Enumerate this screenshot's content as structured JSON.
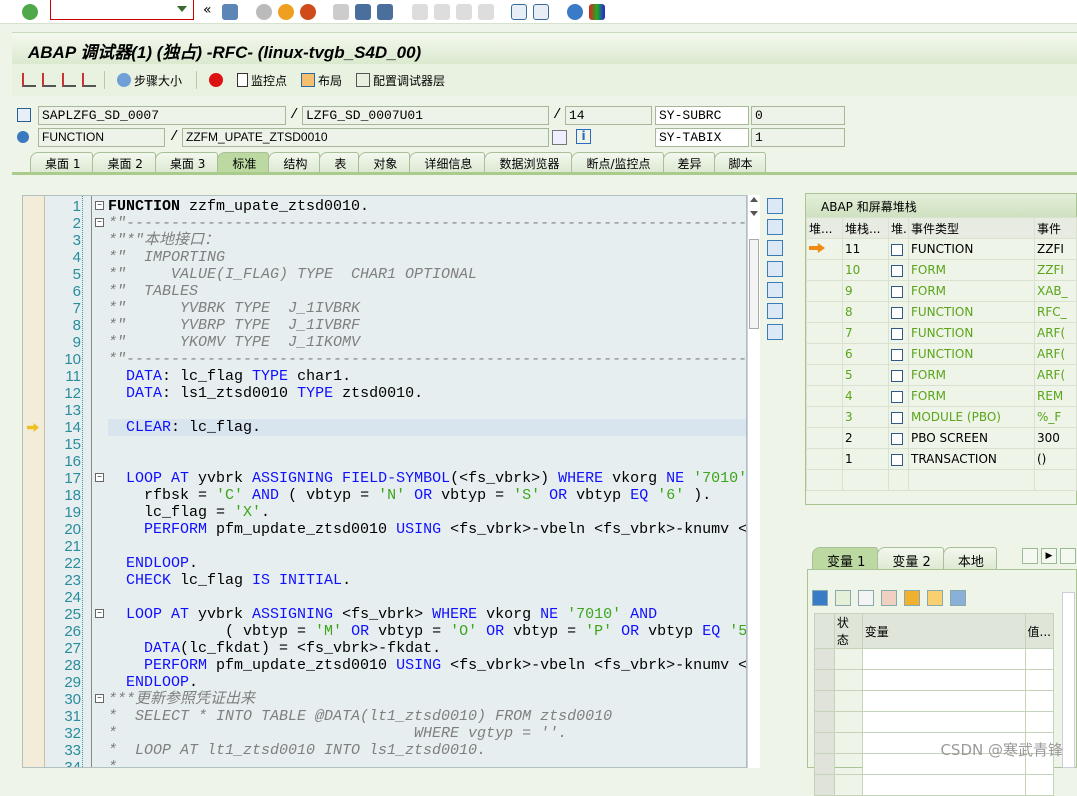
{
  "system_toolbar": {
    "command_field": "",
    "icons": [
      "check-icon",
      "back-icon",
      "save-icon",
      "nav-back-icon",
      "exit-icon",
      "cancel-icon",
      "print-icon",
      "find-icon",
      "find-next-icon",
      "first-page-icon",
      "prev-page-icon",
      "next-page-icon",
      "last-page-icon",
      "new-session-icon",
      "shortcut-icon",
      "help-icon",
      "layout-icon"
    ]
  },
  "title": "ABAP 调试器(1) (独占) -RFC- (linux-tvgb_S4D_00)",
  "app_toolbar": {
    "step_size": "步骤大小",
    "watchpoint": "监控点",
    "layout": "布局",
    "configure": "配置调试器层"
  },
  "fields": {
    "program": "SAPLZFG_SD_0007",
    "include": "LZFG_SD_0007U01",
    "line": "14",
    "event_type": "FUNCTION",
    "event_name": "ZZFM_UPATE_ZTSD0010",
    "sy1_name": "SY-SUBRC",
    "sy1_value": "0",
    "sy2_name": "SY-TABIX",
    "sy2_value": "1"
  },
  "tabs": [
    "桌面 1",
    "桌面 2",
    "桌面 3",
    "标准",
    "结构",
    "表",
    "对象",
    "详细信息",
    "数据浏览器",
    "断点/监控点",
    "差异",
    "脚本"
  ],
  "active_tab": "标准",
  "code": {
    "current_line": 14,
    "lines": [
      [
        [
          "b",
          "FUNCTION"
        ],
        [
          "",
          " zzfm_upate_ztsd0010."
        ]
      ],
      [
        [
          "cm",
          "*\"----------------------------------------------------------------------"
        ]
      ],
      [
        [
          "cm",
          "*\"*\"本地接口："
        ]
      ],
      [
        [
          "cm",
          "*\"  IMPORTING"
        ]
      ],
      [
        [
          "cm",
          "*\"     VALUE(I_FLAG) TYPE  CHAR1 OPTIONAL"
        ]
      ],
      [
        [
          "cm",
          "*\"  TABLES"
        ]
      ],
      [
        [
          "cm",
          "*\"      YVBRK TYPE  J_1IVBRK"
        ]
      ],
      [
        [
          "cm",
          "*\"      YVBRP TYPE  J_1IVBRF"
        ]
      ],
      [
        [
          "cm",
          "*\"      YKOMV TYPE  J_1IKOMV"
        ]
      ],
      [
        [
          "cm",
          "*\"----------------------------------------------------------------------"
        ]
      ],
      [
        [
          "",
          "  "
        ],
        [
          "kw",
          "DATA"
        ],
        [
          "",
          ": lc_flag "
        ],
        [
          "kw",
          "TYPE"
        ],
        [
          "",
          " char1."
        ]
      ],
      [
        [
          "",
          "  "
        ],
        [
          "kw",
          "DATA"
        ],
        [
          "",
          ": ls1_ztsd0010 "
        ],
        [
          "kw",
          "TYPE"
        ],
        [
          "",
          " ztsd0010."
        ]
      ],
      [],
      [
        [
          "",
          "  "
        ],
        [
          "kw",
          "CLEAR"
        ],
        [
          "",
          ": lc_flag."
        ]
      ],
      [],
      [],
      [
        [
          "",
          "  "
        ],
        [
          "kw",
          "LOOP AT"
        ],
        [
          "",
          " yvbrk "
        ],
        [
          "kw",
          "ASSIGNING FIELD-SYMBOL"
        ],
        [
          "",
          "(<fs_vbrk>) "
        ],
        [
          "kw",
          "WHERE"
        ],
        [
          "",
          " vkorg "
        ],
        [
          "kw",
          "NE"
        ],
        [
          "st",
          " '7010'"
        ]
      ],
      [
        [
          "",
          "    rfbsk = "
        ],
        [
          "st",
          "'C'"
        ],
        [
          "kw",
          " AND"
        ],
        [
          "",
          " ( vbtyp = "
        ],
        [
          "st",
          "'N'"
        ],
        [
          "kw",
          " OR"
        ],
        [
          "",
          " vbtyp = "
        ],
        [
          "st",
          "'S'"
        ],
        [
          "kw",
          " OR"
        ],
        [
          "",
          " vbtyp "
        ],
        [
          "kw",
          "EQ"
        ],
        [
          "st",
          " '6'"
        ],
        [
          "",
          " )."
        ]
      ],
      [
        [
          "",
          "    lc_flag = "
        ],
        [
          "st",
          "'X'"
        ],
        [
          "",
          "."
        ]
      ],
      [
        [
          "",
          "    "
        ],
        [
          "kw",
          "PERFORM"
        ],
        [
          "",
          " pfm_update_ztsd0010 "
        ],
        [
          "kw",
          "USING"
        ],
        [
          "",
          " <fs_vbrk>-vbeln <fs_vbrk>-knumv <"
        ]
      ],
      [],
      [
        [
          "",
          "  "
        ],
        [
          "kw",
          "ENDLOOP"
        ],
        [
          "",
          "."
        ]
      ],
      [
        [
          "",
          "  "
        ],
        [
          "kw",
          "CHECK"
        ],
        [
          "",
          " lc_flag "
        ],
        [
          "kw",
          "IS INITIAL"
        ],
        [
          "",
          "."
        ]
      ],
      [],
      [
        [
          "",
          "  "
        ],
        [
          "kw",
          "LOOP AT"
        ],
        [
          "",
          " yvbrk "
        ],
        [
          "kw",
          "ASSIGNING"
        ],
        [
          "",
          " <fs_vbrk> "
        ],
        [
          "kw",
          "WHERE"
        ],
        [
          "",
          " vkorg "
        ],
        [
          "kw",
          "NE"
        ],
        [
          "st",
          " '7010'"
        ],
        [
          "kw",
          " AND"
        ]
      ],
      [
        [
          "",
          "             ( vbtyp = "
        ],
        [
          "st",
          "'M'"
        ],
        [
          "kw",
          " OR"
        ],
        [
          "",
          " vbtyp = "
        ],
        [
          "st",
          "'O'"
        ],
        [
          "kw",
          " OR"
        ],
        [
          "",
          " vbtyp = "
        ],
        [
          "st",
          "'P'"
        ],
        [
          "kw",
          " OR"
        ],
        [
          "",
          " vbtyp "
        ],
        [
          "kw",
          "EQ"
        ],
        [
          "st",
          " '5"
        ]
      ],
      [
        [
          "",
          "    "
        ],
        [
          "kw",
          "DATA"
        ],
        [
          "",
          "(lc_fkdat) = <fs_vbrk>-fkdat."
        ]
      ],
      [
        [
          "",
          "    "
        ],
        [
          "kw",
          "PERFORM"
        ],
        [
          "",
          " pfm_update_ztsd0010 "
        ],
        [
          "kw",
          "USING"
        ],
        [
          "",
          " <fs_vbrk>-vbeln <fs_vbrk>-knumv <"
        ]
      ],
      [
        [
          "",
          "  "
        ],
        [
          "kw",
          "ENDLOOP"
        ],
        [
          "",
          "."
        ]
      ],
      [
        [
          "cm",
          "***更新参照凭证出来"
        ]
      ],
      [
        [
          "cm",
          "*  SELECT * INTO TABLE @DATA(lt1_ztsd0010) FROM ztsd0010"
        ]
      ],
      [
        [
          "cm",
          "*                                 WHERE vgtyp = ''."
        ]
      ],
      [
        [
          "cm",
          "*  LOOP AT lt1_ztsd0010 INTO ls1_ztsd0010."
        ]
      ],
      [
        [
          "cm",
          "*"
        ]
      ]
    ],
    "fold_lines": [
      1,
      2,
      17,
      25,
      30
    ]
  },
  "stack": {
    "title": "ABAP 和屏幕堆栈",
    "columns": [
      "堆...",
      "堆栈...",
      "堆.",
      "事件类型",
      "事件"
    ],
    "rows": [
      {
        "level": "11",
        "icon": "source-icon",
        "type": "FUNCTION",
        "event": "ZZFI",
        "current": true,
        "color": "black"
      },
      {
        "level": "10",
        "icon": "source-icon",
        "type": "FORM",
        "event": "ZZFI",
        "color": "green"
      },
      {
        "level": "9",
        "icon": "source-icon",
        "type": "FORM",
        "event": "XAB_",
        "color": "green"
      },
      {
        "level": "8",
        "icon": "source-icon",
        "type": "FUNCTION",
        "event": "RFC_",
        "color": "green"
      },
      {
        "level": "7",
        "icon": "source-icon",
        "type": "FUNCTION",
        "event": "ARF(",
        "color": "green"
      },
      {
        "level": "6",
        "icon": "source-icon",
        "type": "FUNCTION",
        "event": "ARF(",
        "color": "green"
      },
      {
        "level": "5",
        "icon": "source-icon",
        "type": "FORM",
        "event": "ARF(",
        "color": "green"
      },
      {
        "level": "4",
        "icon": "source-icon",
        "type": "FORM",
        "event": "REM",
        "color": "green"
      },
      {
        "level": "3",
        "icon": "source-icon",
        "type": "MODULE (PBO)",
        "event": "%_F",
        "color": "green"
      },
      {
        "level": "2",
        "icon": "screen-icon",
        "type": "PBO SCREEN",
        "event": "300",
        "color": "black"
      },
      {
        "level": "1",
        "icon": "screen-icon",
        "type": "TRANSACTION",
        "event": "()",
        "color": "black"
      }
    ]
  },
  "variables": {
    "tabs": [
      "变量 1",
      "变量 2",
      "本地"
    ],
    "active_tab": "变量 1",
    "columns": [
      "状态",
      "变量",
      "值..."
    ]
  },
  "colors": {
    "keyword": "#1010ff",
    "comment": "#7f7f7f",
    "string": "#3ca51b",
    "green_text": "#5aa51a"
  },
  "watermark": "CSDN @寒武青锋"
}
